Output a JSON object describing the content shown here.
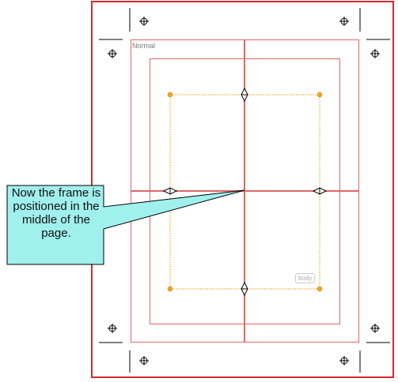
{
  "page_layout": {
    "label": "Normal",
    "frame_tag": "body"
  },
  "callout": {
    "text": "Now the frame is positioned in the middle of the page."
  },
  "colors": {
    "page_border": "#d42a2a",
    "guide_lines": "#e06666",
    "frame_dotted": "#e3a000",
    "handle_fill": "#f5a623",
    "callout_fill": "#a0f0ee"
  }
}
